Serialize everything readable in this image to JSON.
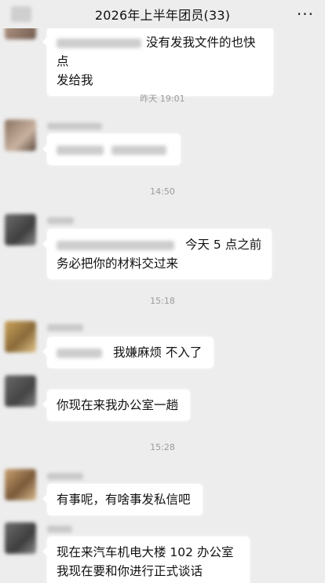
{
  "header": {
    "title": "2026年上半年团员(33)",
    "more_icon": "more-dots-icon"
  },
  "messages": [
    {
      "text_line1": "没有发我文件的也快点",
      "text_line2": "发给我"
    },
    {
      "timestamp": "昨天 19:01"
    },
    {
      "timestamp": "14:50"
    },
    {
      "text_line1": "今天 5 点之前",
      "text_line2": "务必把你的材料交过来"
    },
    {
      "timestamp": "15:18"
    },
    {
      "text": "我嫌麻烦 不入了"
    },
    {
      "text": "你现在来我办公室一趟"
    },
    {
      "timestamp": "15:28"
    },
    {
      "text": "有事呢，有啥事发私信吧"
    },
    {
      "text_line1": "现在来汽车机电大楼 102 办公室",
      "text_line2": "我现在要和你进行正式谈话"
    }
  ]
}
